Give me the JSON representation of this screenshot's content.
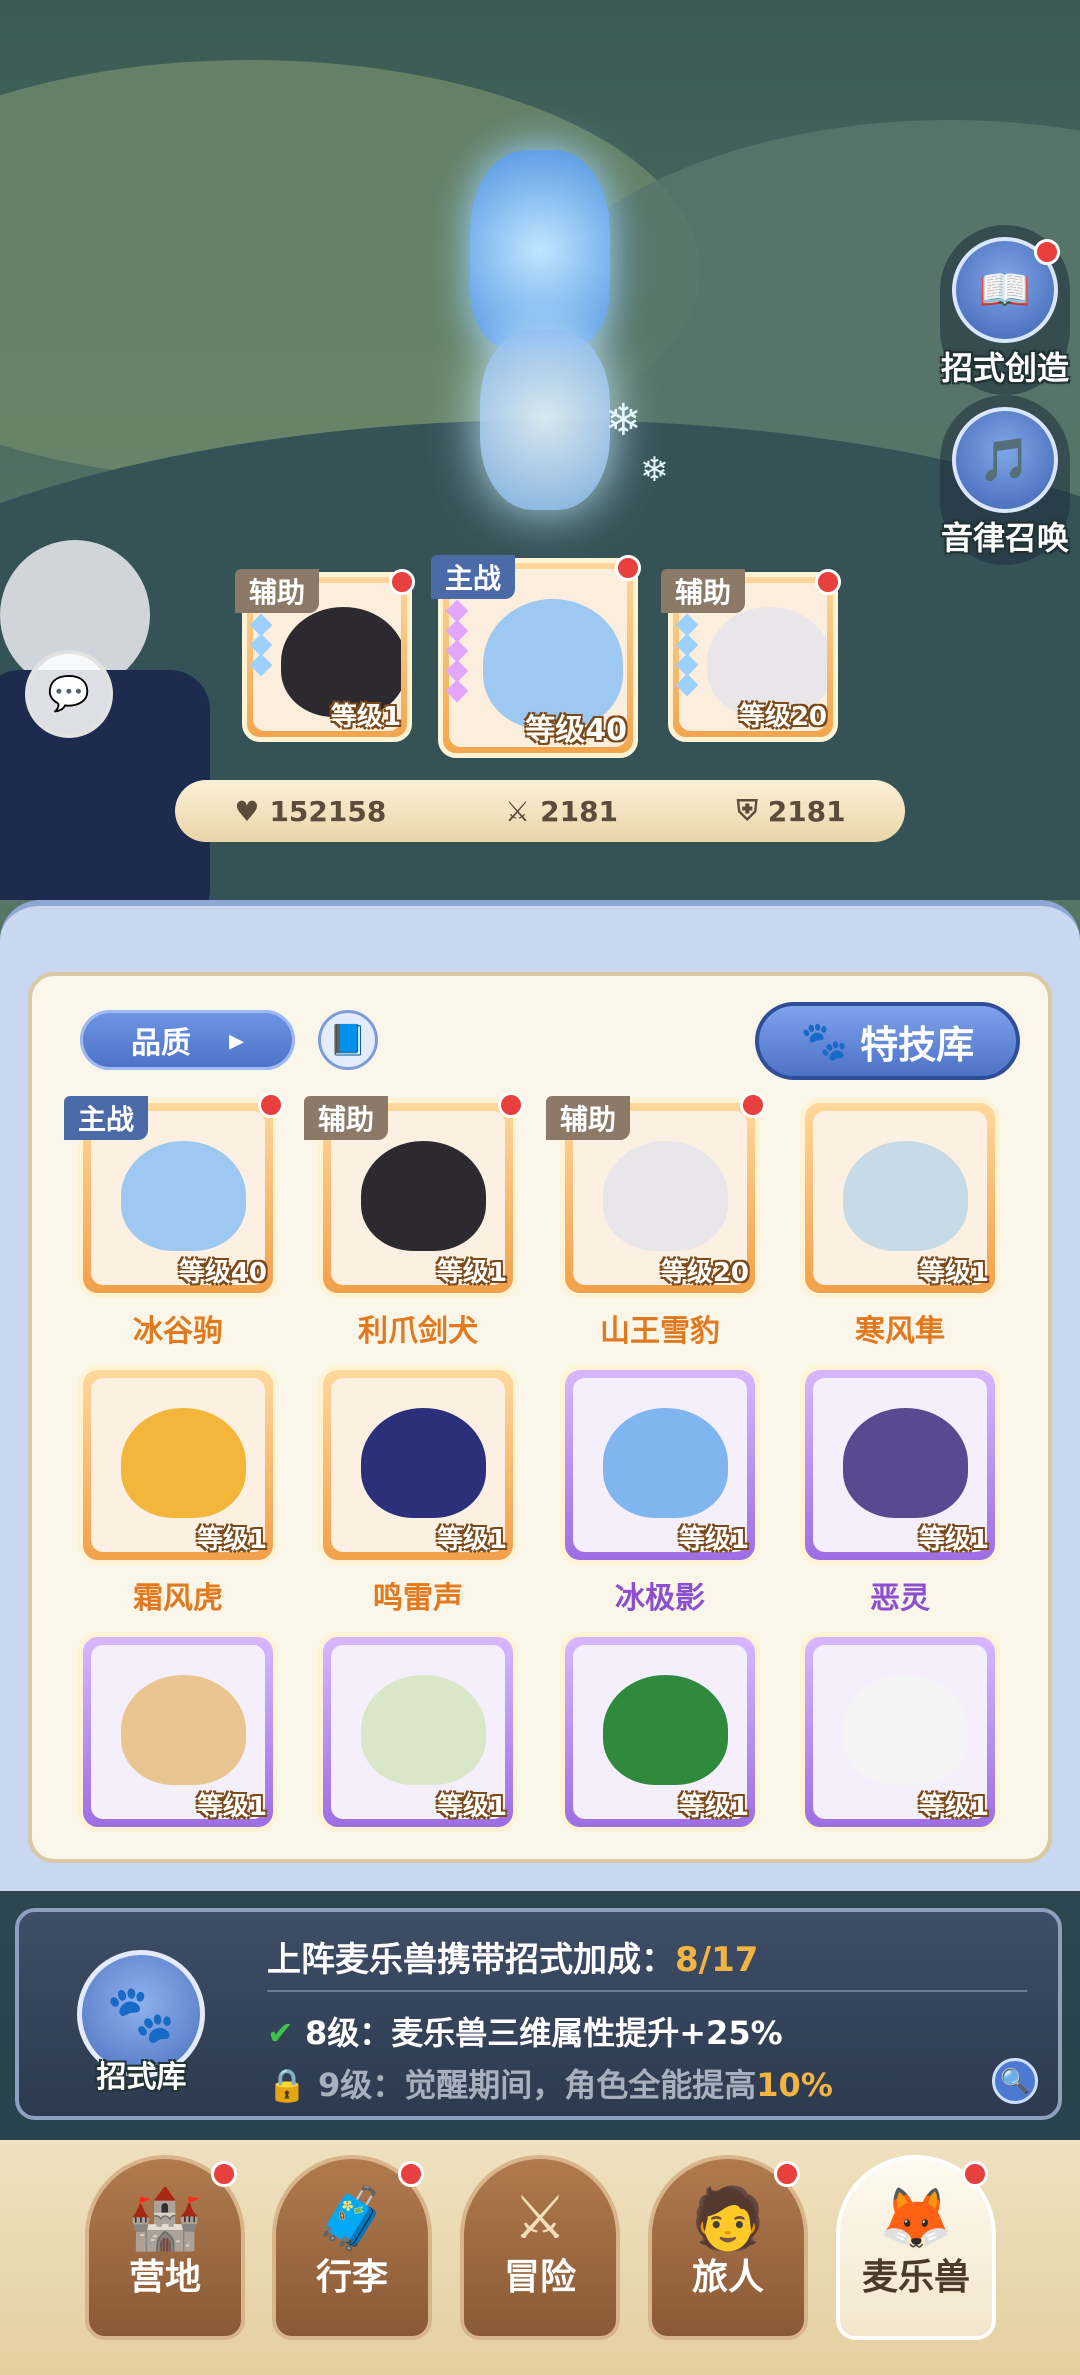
{
  "side_buttons": [
    {
      "label": "招式创造",
      "icon": "tutorial-book-icon"
    },
    {
      "label": "音律召唤",
      "icon": "lyre-icon"
    }
  ],
  "team": [
    {
      "tag": "辅助",
      "level": "等级1",
      "color": "orange"
    },
    {
      "tag": "主战",
      "level": "等级40",
      "color": "orange"
    },
    {
      "tag": "辅助",
      "level": "等级20",
      "color": "orange"
    }
  ],
  "stats": {
    "hp": "152158",
    "attack": "2181",
    "defense": "2181"
  },
  "toolbar": {
    "quality_label": "品质",
    "skill_library_label": "特技库"
  },
  "pets": [
    {
      "name": "冰谷驹",
      "level": "等级40",
      "tag": "主战",
      "rarity": "orange",
      "body": "#9cc8f2"
    },
    {
      "name": "利爪剑犬",
      "level": "等级1",
      "tag": "辅助",
      "rarity": "orange",
      "body": "#2d2a2f"
    },
    {
      "name": "山王雪豹",
      "level": "等级20",
      "tag": "辅助",
      "rarity": "orange",
      "body": "#e9e6ea"
    },
    {
      "name": "寒风隼",
      "level": "等级1",
      "tag": "",
      "rarity": "orange",
      "body": "#c6dbe6"
    },
    {
      "name": "霜风虎",
      "level": "等级1",
      "tag": "",
      "rarity": "orange",
      "body": "#f4b53b"
    },
    {
      "name": "鸣雷声",
      "level": "等级1",
      "tag": "",
      "rarity": "orange",
      "body": "#2c2f7a"
    },
    {
      "name": "冰极影",
      "level": "等级1",
      "tag": "",
      "rarity": "purple",
      "body": "#7fb6f0"
    },
    {
      "name": "恶灵",
      "level": "等级1",
      "tag": "",
      "rarity": "purple",
      "body": "#5a4890"
    },
    {
      "name": "",
      "level": "等级1",
      "tag": "",
      "rarity": "purple",
      "body": "#e9c690"
    },
    {
      "name": "",
      "level": "等级1",
      "tag": "",
      "rarity": "purple",
      "body": "#d9e6c8"
    },
    {
      "name": "",
      "level": "等级1",
      "tag": "",
      "rarity": "purple",
      "body": "#2f8a3e"
    },
    {
      "name": "",
      "level": "等级1",
      "tag": "",
      "rarity": "purple",
      "body": "#f4f4f4"
    }
  ],
  "bonus": {
    "title": "上阵麦乐兽携带招式加成：",
    "count": "8/17",
    "row1_level": "8级：",
    "row1_text": "麦乐兽三维属性提升+25%",
    "row2_level": "9级：",
    "row2_text_a": "觉醒期间，角色全能提高",
    "row2_value": "10%",
    "library_label": "招式库"
  },
  "nav": [
    {
      "label": "营地",
      "icon": "castle-icon",
      "badge": true
    },
    {
      "label": "行李",
      "icon": "bag-icon",
      "badge": true
    },
    {
      "label": "冒险",
      "icon": "swords-icon",
      "badge": false
    },
    {
      "label": "旅人",
      "icon": "traveler-icon",
      "badge": true
    },
    {
      "label": "麦乐兽",
      "icon": "fox-icon",
      "badge": true,
      "active": true
    }
  ]
}
